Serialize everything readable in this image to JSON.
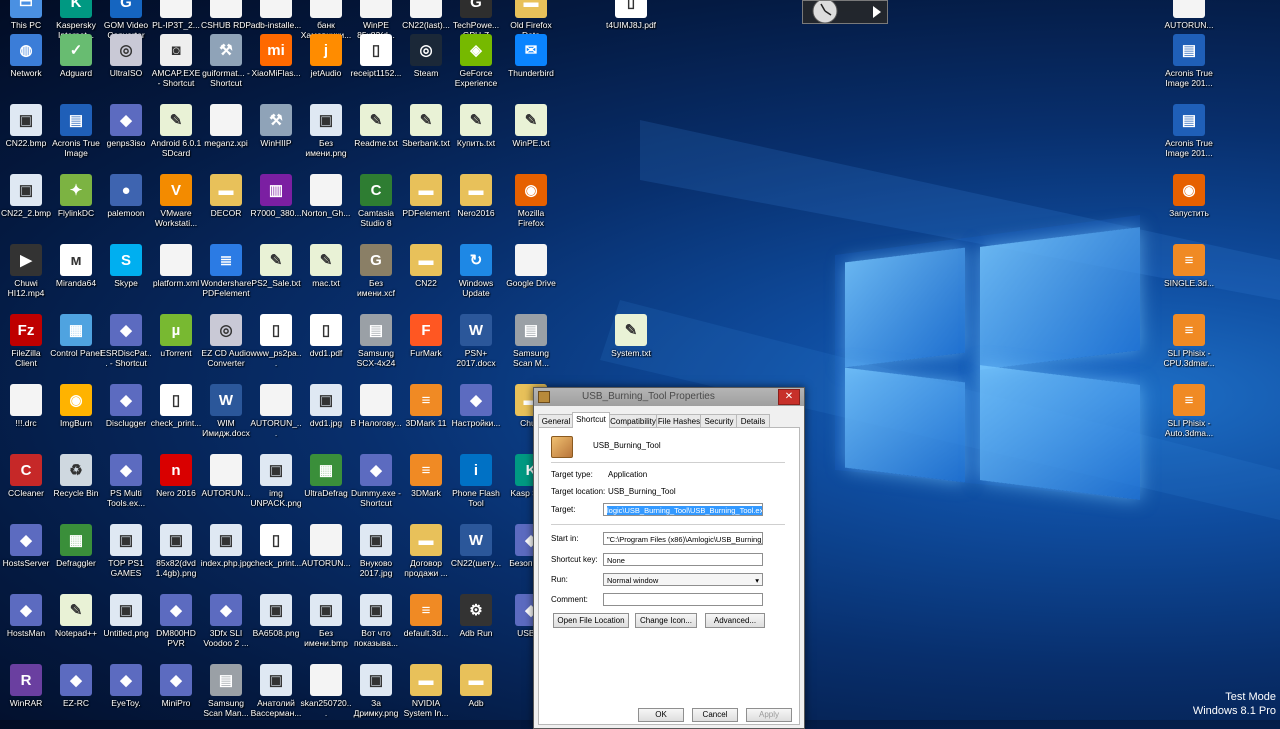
{
  "colors": {
    "accent": "#3399ff",
    "desktop": "#0b3a80",
    "close": "#c7302a"
  },
  "desktop_icons": [
    {
      "label": "This PC",
      "glyph": "computer-icon"
    },
    {
      "label": "Kaspersky Internet...",
      "glyph": "kaspersky-icon"
    },
    {
      "label": "GOM Video Converter",
      "glyph": "gom-icon"
    },
    {
      "label": "PL-IP3T_2...",
      "glyph": "file-icon"
    },
    {
      "label": "CSHUB RDP",
      "glyph": "file-icon"
    },
    {
      "label": "adb-installe...",
      "glyph": "file-icon"
    },
    {
      "label": "банк Хамовники...",
      "glyph": "file-icon"
    },
    {
      "label": "WinPE 85x82(d...",
      "glyph": "file-icon"
    },
    {
      "label": "CN22(last)...",
      "glyph": "file-icon"
    },
    {
      "label": "TechPowe... GPU-Z",
      "glyph": "gpuz-icon"
    },
    {
      "label": "Old Firefox Data",
      "glyph": "folder-icon"
    },
    {
      "label": "t4UIMJ8J.pdf",
      "glyph": "pdf-icon"
    },
    {
      "label": "AUTORUN...",
      "glyph": "file-icon"
    },
    {
      "label": "Network",
      "glyph": "network-icon"
    },
    {
      "label": "Adguard",
      "glyph": "adguard-icon"
    },
    {
      "label": "UltraISO",
      "glyph": "disc-icon"
    },
    {
      "label": "AMCAP.EXE - Shortcut",
      "glyph": "camera-icon"
    },
    {
      "label": "guiformat... - Shortcut",
      "glyph": "tool-icon"
    },
    {
      "label": "XiaoMiFlas...",
      "glyph": "mi-icon"
    },
    {
      "label": "jetAudio",
      "glyph": "jetaudio-icon"
    },
    {
      "label": "receipt1152...",
      "glyph": "pdf-icon"
    },
    {
      "label": "Steam",
      "glyph": "steam-icon"
    },
    {
      "label": "GeForce Experience",
      "glyph": "nvidia-icon"
    },
    {
      "label": "Thunderbird",
      "glyph": "thunderbird-icon"
    },
    {
      "label": "Acronis True Image 201...",
      "glyph": "acronis-icon"
    },
    {
      "label": "CN22.bmp",
      "glyph": "image-icon"
    },
    {
      "label": "Acronis True Image",
      "glyph": "acronis-icon"
    },
    {
      "label": "genps3iso",
      "glyph": "app-icon"
    },
    {
      "label": "Android 6.0.1 SDcard FIX.txt",
      "glyph": "notepad-icon"
    },
    {
      "label": "meganz.xpi",
      "glyph": "file-icon"
    },
    {
      "label": "WinHIIP",
      "glyph": "tool-icon"
    },
    {
      "label": "Без имени.png",
      "glyph": "image-icon"
    },
    {
      "label": "Readme.txt",
      "glyph": "notepad-icon"
    },
    {
      "label": "Sberbank.txt",
      "glyph": "notepad-icon"
    },
    {
      "label": "Купить.txt",
      "glyph": "notepad-icon"
    },
    {
      "label": "WinPE.txt",
      "glyph": "notepad-icon"
    },
    {
      "label": "Acronis True Image 201...",
      "glyph": "acronis-icon"
    },
    {
      "label": "CN22_2.bmp",
      "glyph": "image-icon"
    },
    {
      "label": "FlylinkDC",
      "glyph": "flylink-icon"
    },
    {
      "label": "palemoon",
      "glyph": "palemoon-icon"
    },
    {
      "label": "VMware Workstati...",
      "glyph": "vmware-icon"
    },
    {
      "label": "DECOR",
      "glyph": "folder-icon"
    },
    {
      "label": "R7000_380...",
      "glyph": "archive-icon"
    },
    {
      "label": "Norton_Gh...",
      "glyph": "file-icon"
    },
    {
      "label": "Camtasia Studio 8",
      "glyph": "camtasia-icon"
    },
    {
      "label": "PDFelement",
      "glyph": "folder-icon"
    },
    {
      "label": "Nero2016",
      "glyph": "folder-icon"
    },
    {
      "label": "Mozilla Firefox",
      "glyph": "firefox-icon"
    },
    {
      "label": "Запустить",
      "glyph": "firefox-icon"
    },
    {
      "label": "Chuwi HI12.mp4",
      "glyph": "video-icon"
    },
    {
      "label": "Miranda64",
      "glyph": "miranda-icon"
    },
    {
      "label": "Skype",
      "glyph": "skype-icon"
    },
    {
      "label": "platform.xml",
      "glyph": "file-icon"
    },
    {
      "label": "Wondershare PDFelement",
      "glyph": "pdfelement-icon"
    },
    {
      "label": "PS2_Sale.txt",
      "glyph": "notepad-icon"
    },
    {
      "label": "mac.txt",
      "glyph": "notepad-icon"
    },
    {
      "label": "Без имени.xcf",
      "glyph": "gimp-icon"
    },
    {
      "label": "CN22",
      "glyph": "folder-icon"
    },
    {
      "label": "Windows Update",
      "glyph": "update-icon"
    },
    {
      "label": "Google Drive",
      "glyph": "file-icon"
    },
    {
      "label": "SINGLE.3d...",
      "glyph": "3dmark-icon"
    },
    {
      "label": "FileZilla Client",
      "glyph": "filezilla-icon"
    },
    {
      "label": "Control Panel",
      "glyph": "controlpanel-icon"
    },
    {
      "label": "ESRDiscPat... - Shortcut",
      "glyph": "app-icon"
    },
    {
      "label": "uTorrent",
      "glyph": "utorrent-icon"
    },
    {
      "label": "EZ CD Audio Converter",
      "glyph": "disc-icon"
    },
    {
      "label": "www_ps2pa...",
      "glyph": "pdf-icon"
    },
    {
      "label": "dvd1.pdf",
      "glyph": "pdf-icon"
    },
    {
      "label": "Samsung SCX-4x24 S...",
      "glyph": "printer-icon"
    },
    {
      "label": "FurMark",
      "glyph": "furmark-icon"
    },
    {
      "label": "PSN+ 2017.docx",
      "glyph": "word-icon"
    },
    {
      "label": "Samsung Scan M...",
      "glyph": "printer-icon"
    },
    {
      "label": "System.txt",
      "glyph": "notepad-icon"
    },
    {
      "label": "SLI Phisix - CPU.3dmar...",
      "glyph": "3dmark-icon"
    },
    {
      "label": "!!!.drc",
      "glyph": "file-icon"
    },
    {
      "label": "ImgBurn",
      "glyph": "imgburn-icon"
    },
    {
      "label": "Disclugger",
      "glyph": "app-icon"
    },
    {
      "label": "check_print...",
      "glyph": "pdf-icon"
    },
    {
      "label": "WIM Имидж.docx",
      "glyph": "word-icon"
    },
    {
      "label": "AUTORUN_...",
      "glyph": "file-icon"
    },
    {
      "label": "dvd1.jpg",
      "glyph": "image-icon"
    },
    {
      "label": "В Налогову...",
      "glyph": "file-icon"
    },
    {
      "label": "3DMark 11",
      "glyph": "3dmark-icon"
    },
    {
      "label": "Настройки...",
      "glyph": "app-icon"
    },
    {
      "label": "Chuw",
      "glyph": "folder-icon"
    },
    {
      "label": "SLI Phisix - Auto.3dma...",
      "glyph": "3dmark-icon"
    },
    {
      "label": "CCleaner",
      "glyph": "ccleaner-icon"
    },
    {
      "label": "Recycle Bin",
      "glyph": "recycle-icon"
    },
    {
      "label": "PS Multi Tools.ex...",
      "glyph": "app-icon"
    },
    {
      "label": "Nero 2016",
      "glyph": "nero-icon"
    },
    {
      "label": "AUTORUN...",
      "glyph": "file-icon"
    },
    {
      "label": "img UNPACK.png",
      "glyph": "image-icon"
    },
    {
      "label": "UltraDefrag",
      "glyph": "defrag-icon"
    },
    {
      "label": "Dummy.exe - Shortcut",
      "glyph": "app-icon"
    },
    {
      "label": "3DMark",
      "glyph": "3dmark-icon"
    },
    {
      "label": "Phone Flash Tool",
      "glyph": "intel-icon"
    },
    {
      "label": "Kasp Secu",
      "glyph": "kaspersky-icon"
    },
    {
      "label": "HostsServer",
      "glyph": "app-icon"
    },
    {
      "label": "Defraggler",
      "glyph": "defrag-icon"
    },
    {
      "label": "TOP PS1 GAMES (PA...",
      "glyph": "image-icon"
    },
    {
      "label": "85x82(dvd 1.4gb).png",
      "glyph": "image-icon"
    },
    {
      "label": "index.php.jpg",
      "glyph": "image-icon"
    },
    {
      "label": "check_print...",
      "glyph": "pdf-icon"
    },
    {
      "label": "AUTORUN...",
      "glyph": "file-icon"
    },
    {
      "label": "Внуково 2017.jpg",
      "glyph": "image-icon"
    },
    {
      "label": "Договор продажи ...",
      "glyph": "folder-icon"
    },
    {
      "label": "CN22(шету...",
      "glyph": "word-icon"
    },
    {
      "label": "Безоп плат",
      "glyph": "app-icon"
    },
    {
      "label": "HostsMan",
      "glyph": "app-icon"
    },
    {
      "label": "Notepad++",
      "glyph": "notepad-icon"
    },
    {
      "label": "Untitled.png",
      "glyph": "image-icon"
    },
    {
      "label": "DM800HD PVR",
      "glyph": "app-icon"
    },
    {
      "label": "3Dfx SLI Voodoo 2 ...",
      "glyph": "app-icon"
    },
    {
      "label": "BA6508.png",
      "glyph": "image-icon"
    },
    {
      "label": "Без имени.bmp",
      "glyph": "image-icon"
    },
    {
      "label": "Вот что показыва...",
      "glyph": "image-icon"
    },
    {
      "label": "default.3d...",
      "glyph": "3dmark-icon"
    },
    {
      "label": "Adb Run",
      "glyph": "adb-icon"
    },
    {
      "label": "USB_B",
      "glyph": "app-icon"
    },
    {
      "label": "WinRAR",
      "glyph": "winrar-icon"
    },
    {
      "label": "EZ-RC",
      "glyph": "app-icon"
    },
    {
      "label": "EyeToy.",
      "glyph": "app-icon"
    },
    {
      "label": "MiniPro",
      "glyph": "app-icon"
    },
    {
      "label": "Samsung Scan Man...",
      "glyph": "printer-icon"
    },
    {
      "label": "Анатолий Вассерман...",
      "glyph": "image-icon"
    },
    {
      "label": "skan250720...",
      "glyph": "file-icon"
    },
    {
      "label": "За Дримку.png",
      "glyph": "image-icon"
    },
    {
      "label": "NVIDIA System In...",
      "glyph": "folder-icon"
    },
    {
      "label": "Adb",
      "glyph": "folder-icon"
    }
  ],
  "dialog": {
    "title": "USB_Burning_Tool Properties",
    "tabs": [
      "General",
      "Shortcut",
      "Compatibility",
      "File Hashes",
      "Security",
      "Details"
    ],
    "active_tab": "Shortcut",
    "app_name": "USB_Burning_Tool",
    "target_type_label": "Target type:",
    "target_type_value": "Application",
    "target_location_label": "Target location:",
    "target_location_value": "USB_Burning_Tool",
    "target_label": "Target:",
    "target_value": "logic\\USB_Burning_Tool\\USB_Burning_Tool.exe\"",
    "start_in_label": "Start in:",
    "start_in_value": "\"C:\\Program Files (x86)\\Amlogic\\USB_Burning_To",
    "shortcut_key_label": "Shortcut key:",
    "shortcut_key_value": "None",
    "run_label": "Run:",
    "run_value": "Normal window",
    "comment_label": "Comment:",
    "comment_value": "",
    "open_file_location": "Open File Location",
    "change_icon": "Change Icon...",
    "advanced": "Advanced...",
    "ok": "OK",
    "cancel": "Cancel",
    "apply": "Apply",
    "close_glyph": "✕"
  },
  "watermark": {
    "line1": "Test Mode",
    "line2": "Windows 8.1 Pro"
  }
}
